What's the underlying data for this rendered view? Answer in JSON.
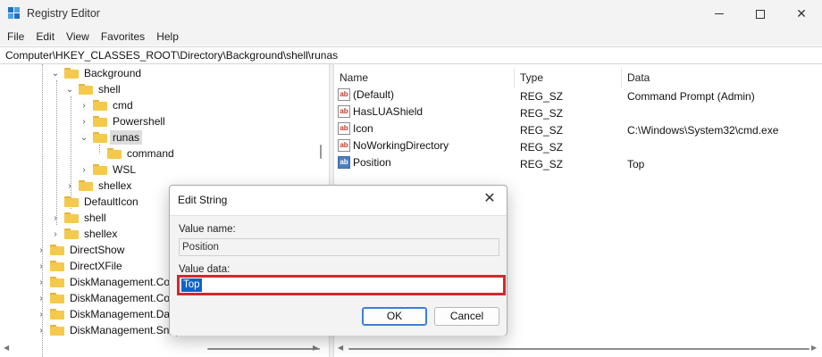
{
  "window": {
    "title": "Registry Editor",
    "icon": "registry-editor-icon"
  },
  "menu": [
    "File",
    "Edit",
    "View",
    "Favorites",
    "Help"
  ],
  "address": "Computer\\HKEY_CLASSES_ROOT\\Directory\\Background\\shell\\runas",
  "tree": {
    "items": [
      {
        "label": "Background"
      },
      {
        "label": "shell"
      },
      {
        "label": "cmd"
      },
      {
        "label": "Powershell"
      },
      {
        "label": "runas"
      },
      {
        "label": "command"
      },
      {
        "label": "WSL"
      },
      {
        "label": "shellex"
      },
      {
        "label": "DefaultIcon"
      },
      {
        "label": "shell"
      },
      {
        "label": "shellex"
      },
      {
        "label": "DirectShow"
      },
      {
        "label": "DirectXFile"
      },
      {
        "label": "DiskManagement.Cor"
      },
      {
        "label": "DiskManagement.Cor"
      },
      {
        "label": "DiskManagement.Dat"
      },
      {
        "label": "DiskManagement.Snap"
      }
    ]
  },
  "list": {
    "columns": {
      "name": "Name",
      "type": "Type",
      "data": "Data"
    },
    "rows": [
      {
        "name": "(Default)",
        "type": "REG_SZ",
        "data": "Command Prompt (Admin)",
        "icon": "ab"
      },
      {
        "name": "HasLUAShield",
        "type": "REG_SZ",
        "data": "",
        "icon": "ab"
      },
      {
        "name": "Icon",
        "type": "REG_SZ",
        "data": "C:\\Windows\\System32\\cmd.exe",
        "icon": "ab"
      },
      {
        "name": "NoWorkingDirectory",
        "type": "REG_SZ",
        "data": "",
        "icon": "ab"
      },
      {
        "name": "Position",
        "type": "REG_SZ",
        "data": "Top",
        "icon": "ab"
      }
    ]
  },
  "dialog": {
    "title": "Edit String",
    "value_name_label": "Value name:",
    "value_name": "Position",
    "value_data_label": "Value data:",
    "value_data": "Top",
    "ok_label": "OK",
    "cancel_label": "Cancel",
    "highlight_color": "#d6262e"
  }
}
